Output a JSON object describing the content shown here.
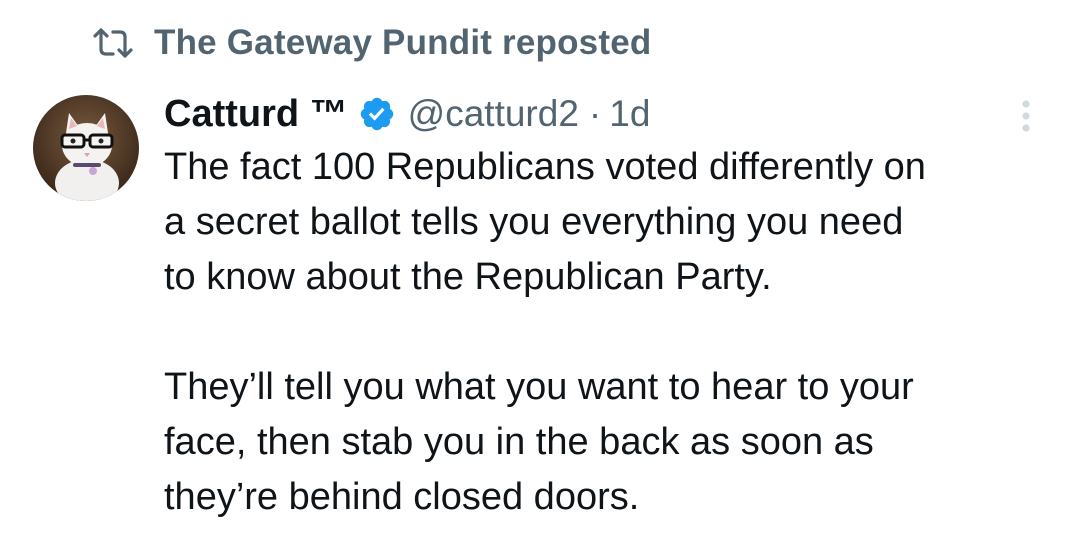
{
  "repost": {
    "icon": "repost-icon",
    "label": "The Gateway Pundit reposted"
  },
  "tweet": {
    "author": {
      "avatar": "cat-with-glasses-avatar",
      "display_name": "Catturd ™",
      "verified": true,
      "handle": "@catturd2",
      "separator": "·",
      "time": "1d"
    },
    "more_icon": "vertical-dots-icon",
    "text_lines_p1": [
      "The fact 100 Republicans voted differently on",
      "a secret ballot tells you everything you need",
      "to know about the Republican Party."
    ],
    "text_lines_p2": [
      "They’ll tell you what you want to hear to your",
      "face, then stab you in the back as soon as",
      "they’re behind closed doors."
    ]
  },
  "colors": {
    "text_primary": "#0f1419",
    "text_secondary": "#536471",
    "verified_blue": "#1d9bf0"
  }
}
